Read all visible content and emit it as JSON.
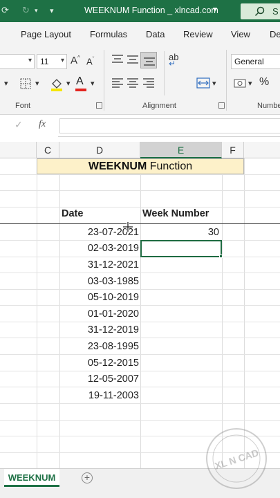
{
  "titlebar": {
    "title": "WEEKNUM Function _ xlncad.com",
    "search_label": "S"
  },
  "menu": {
    "tabs": [
      "Page Layout",
      "Formulas",
      "Data",
      "Review",
      "View",
      "De"
    ]
  },
  "ribbon": {
    "font_size": "11",
    "number_format": "General",
    "font_group_label": "Font",
    "alignment_group_label": "Alignment",
    "number_group_label": "Numbe"
  },
  "formula_bar": {
    "fx_label": "fx",
    "value": ""
  },
  "columns": [
    "C",
    "D",
    "E",
    "F"
  ],
  "selected_column": "E",
  "sheet": {
    "title_bold": "WEEKNUM",
    "title_rest": " Function",
    "header_date": "Date",
    "header_week": "Week Number",
    "rows": [
      {
        "date": "23-07-2021",
        "week": "30"
      },
      {
        "date": "02-03-2019",
        "week": ""
      },
      {
        "date": "31-12-2021",
        "week": ""
      },
      {
        "date": "03-03-1985",
        "week": ""
      },
      {
        "date": "05-10-2019",
        "week": ""
      },
      {
        "date": "01-01-2020",
        "week": ""
      },
      {
        "date": "31-12-2019",
        "week": ""
      },
      {
        "date": "23-08-1995",
        "week": ""
      },
      {
        "date": "05-12-2015",
        "week": ""
      },
      {
        "date": "12-05-2007",
        "week": ""
      },
      {
        "date": "19-11-2003",
        "week": ""
      }
    ]
  },
  "sheet_tabs": {
    "active": "WEEKNUM",
    "add_symbol": "+"
  },
  "watermark": {
    "text": "XL N CAD"
  },
  "colors": {
    "excel_green": "#1e7145",
    "title_fill": "#fdf1c9"
  }
}
